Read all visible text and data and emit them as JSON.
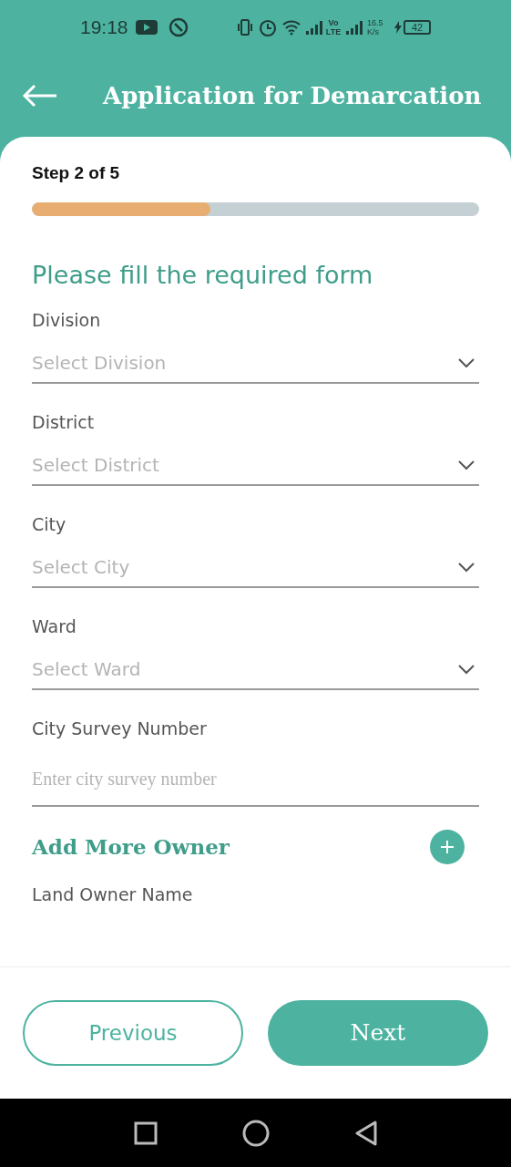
{
  "status_bar": {
    "time": "19:18",
    "network_type": "Vo LTE",
    "speed": "16.5 K/s",
    "battery": "42"
  },
  "header": {
    "title": "Application for Demarcation"
  },
  "progress": {
    "label": "Step 2 of 5",
    "level": 0.4
  },
  "form": {
    "heading": "Please fill the required form",
    "fields": [
      {
        "kind": "select",
        "label": "Division",
        "placeholder": "Select Division"
      },
      {
        "kind": "select",
        "label": "District",
        "placeholder": "Select District"
      },
      {
        "kind": "select",
        "label": "City",
        "placeholder": "Select City"
      },
      {
        "kind": "select",
        "label": "Ward",
        "placeholder": "Select Ward"
      },
      {
        "kind": "text",
        "label": "City Survey Number",
        "placeholder": "Enter city survey number"
      }
    ],
    "add_owner": {
      "label": "Add More Owner"
    },
    "owner_field": {
      "label": "Land Owner Name"
    }
  },
  "buttons": {
    "previous": "Previous",
    "next": "Next"
  }
}
